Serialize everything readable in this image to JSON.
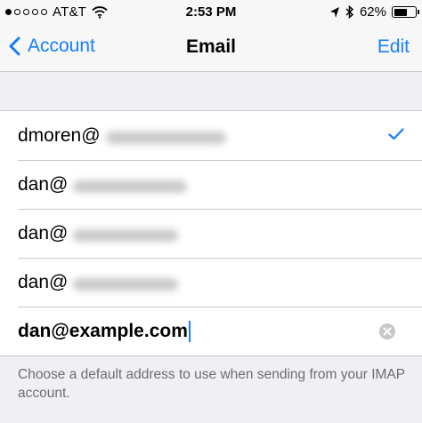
{
  "status_bar": {
    "carrier": "AT&T",
    "time": "2:53 PM",
    "battery_percent_label": "62%",
    "battery_level": 0.62
  },
  "nav": {
    "back_label": "Account",
    "title": "Email",
    "edit_label": "Edit"
  },
  "emails": {
    "items": [
      {
        "local_part": "dmoren@",
        "selected": true
      },
      {
        "local_part": "dan@",
        "selected": false
      },
      {
        "local_part": "dan@",
        "selected": false
      },
      {
        "local_part": "dan@",
        "selected": false
      }
    ],
    "editing_value": "dan@example.com"
  },
  "footer": {
    "text": "Choose a default address to use when sending from your IMAP account."
  },
  "colors": {
    "accent": "#157efb",
    "background": "#efeff4",
    "separator": "#c8c7cc"
  }
}
